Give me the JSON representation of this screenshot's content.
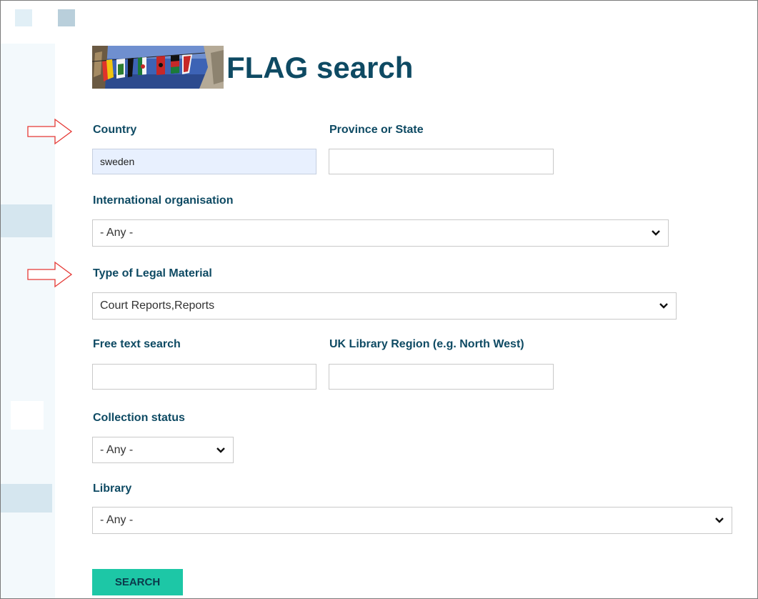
{
  "header": {
    "title": "FLAG search"
  },
  "form": {
    "country": {
      "label": "Country",
      "value": "sweden"
    },
    "province": {
      "label": "Province or State",
      "value": ""
    },
    "intl_org": {
      "label": "International organisation",
      "value": "- Any -"
    },
    "legal_material": {
      "label": "Type of Legal Material",
      "value": "Court Reports,Reports"
    },
    "free_text": {
      "label": "Free text search",
      "value": ""
    },
    "uk_region": {
      "label": "UK Library Region (e.g. North West)",
      "value": ""
    },
    "collection_status": {
      "label": "Collection status",
      "value": "- Any -"
    },
    "library": {
      "label": "Library",
      "value": "- Any -"
    },
    "search_button": "SEARCH"
  },
  "colors": {
    "heading": "#0e4a63",
    "button": "#1dc7a6",
    "annotation_arrow": "#e53935",
    "autofill": "#e8f0fe"
  },
  "icons": [
    "annotation-arrow-icon",
    "chevron-down-icon",
    "flags-banner-image"
  ]
}
